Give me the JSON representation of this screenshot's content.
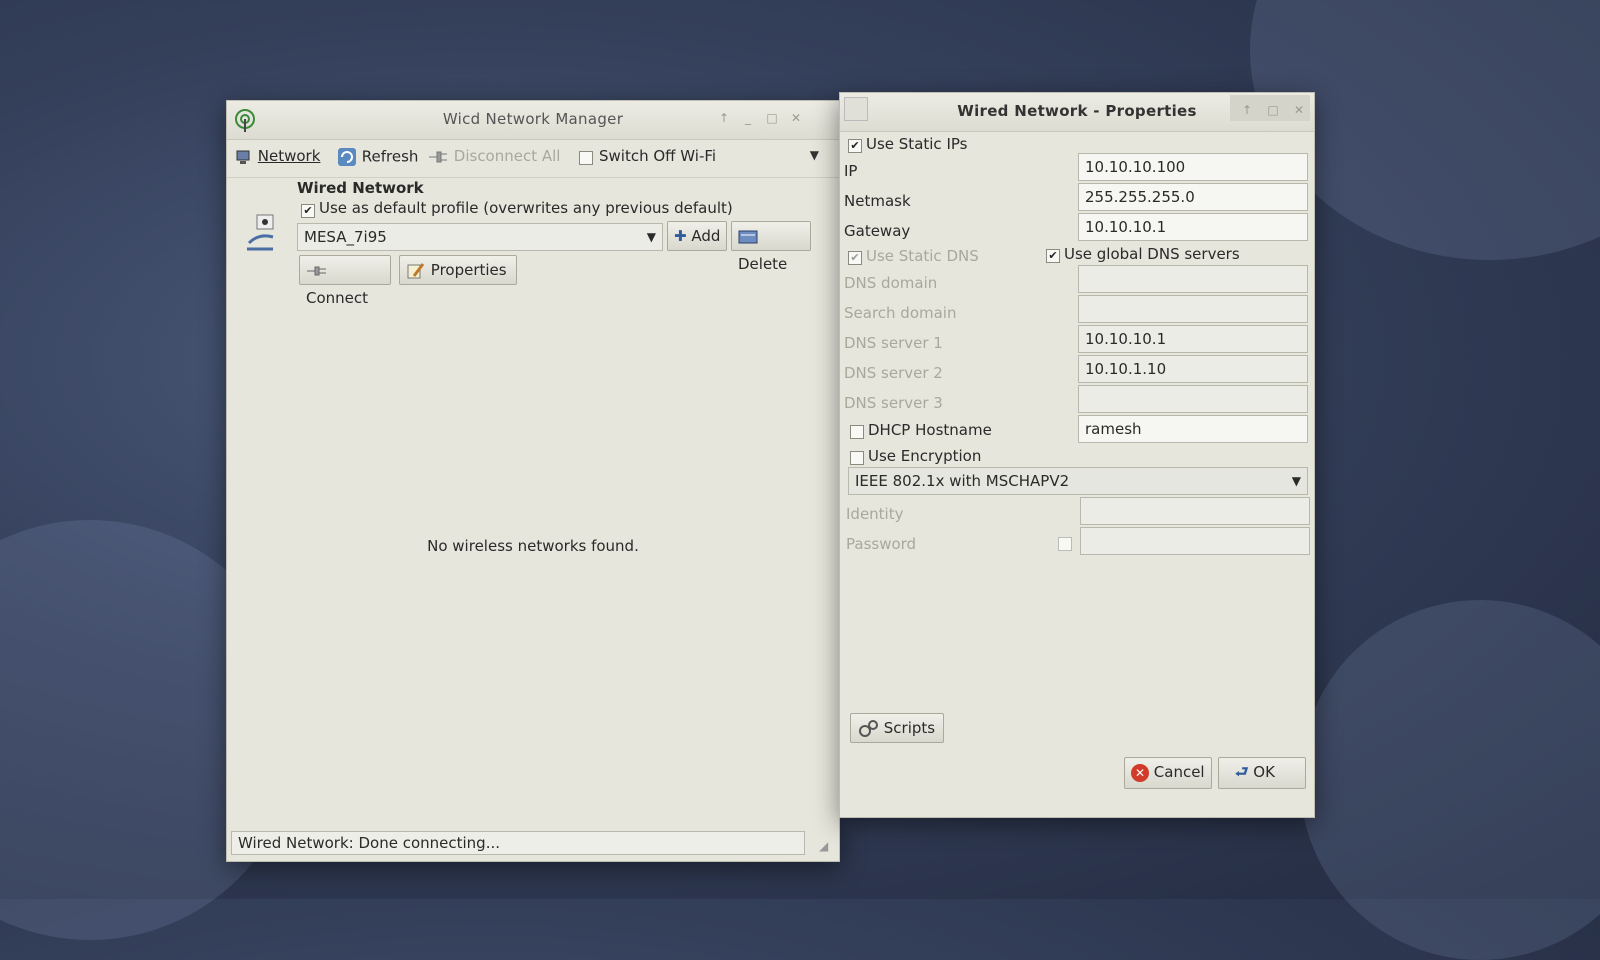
{
  "manager": {
    "title": "Wicd Network Manager",
    "toolbar": {
      "network": "Network",
      "refresh": "Refresh",
      "disconnect_all": "Disconnect All",
      "switch_off_wifi": "Switch Off Wi-Fi"
    },
    "wired": {
      "heading": "Wired Network",
      "default_profile_label": "Use as default profile (overwrites any previous default)",
      "default_profile_checked": true,
      "profile": "MESA_7i95",
      "add": "Add",
      "delete": "Delete",
      "connect": "Connect",
      "properties": "Properties"
    },
    "no_networks": "No wireless networks found.",
    "status": "Wired Network: Done connecting..."
  },
  "props": {
    "title": "Wired Network - Properties",
    "use_static_ips": "Use Static IPs",
    "ip_label": "IP",
    "ip": "10.10.10.100",
    "netmask_label": "Netmask",
    "netmask": "255.255.255.0",
    "gateway_label": "Gateway",
    "gateway": "10.10.10.1",
    "use_static_dns": "Use Static DNS",
    "use_global_dns": "Use global DNS servers",
    "dns_domain_label": "DNS domain",
    "dns_domain": "",
    "search_domain_label": "Search domain",
    "search_domain": "",
    "dns1_label": "DNS server 1",
    "dns1": "10.10.10.1",
    "dns2_label": "DNS server 2",
    "dns2": "10.10.1.10",
    "dns3_label": "DNS server 3",
    "dns3": "",
    "dhcp_hostname_label": "DHCP Hostname",
    "dhcp_hostname": "ramesh",
    "use_encryption": "Use Encryption",
    "encryption_type": "IEEE 802.1x with MSCHAPV2",
    "identity_label": "Identity",
    "identity": "",
    "password_label": "Password",
    "password": "",
    "scripts": "Scripts",
    "cancel": "Cancel",
    "ok": "OK"
  }
}
